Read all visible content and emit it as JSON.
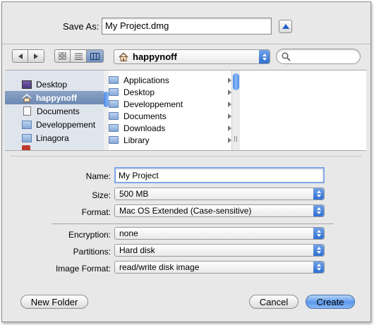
{
  "save_as": {
    "label": "Save As:",
    "value": "My Project.dmg"
  },
  "toolbar": {
    "location": "happynoff"
  },
  "sidebar": {
    "items": [
      {
        "label": "Desktop",
        "icon": "desktop-icon"
      },
      {
        "label": "happynoff",
        "icon": "home-icon",
        "selected": true
      },
      {
        "label": "Documents",
        "icon": "document-icon"
      },
      {
        "label": "Developpement",
        "icon": "folder-icon"
      },
      {
        "label": "Linagora",
        "icon": "folder-icon"
      }
    ]
  },
  "column": {
    "items": [
      "Applications",
      "Desktop",
      "Developpement",
      "Documents",
      "Downloads",
      "Library"
    ]
  },
  "form": {
    "name": {
      "label": "Name:",
      "value": "My Project"
    },
    "size": {
      "label": "Size:",
      "value": "500 MB"
    },
    "format": {
      "label": "Format:",
      "value": "Mac OS Extended (Case-sensitive)"
    },
    "encryption": {
      "label": "Encryption:",
      "value": "none"
    },
    "partitions": {
      "label": "Partitions:",
      "value": "Hard disk"
    },
    "image_format": {
      "label": "Image Format:",
      "value": "read/write disk image"
    }
  },
  "buttons": {
    "new_folder": "New Folder",
    "cancel": "Cancel",
    "create": "Create"
  },
  "colors": {
    "accent": "#3b7be0",
    "sidebar_bg": "#dfe5ed",
    "selection": "#6e8ab3"
  }
}
